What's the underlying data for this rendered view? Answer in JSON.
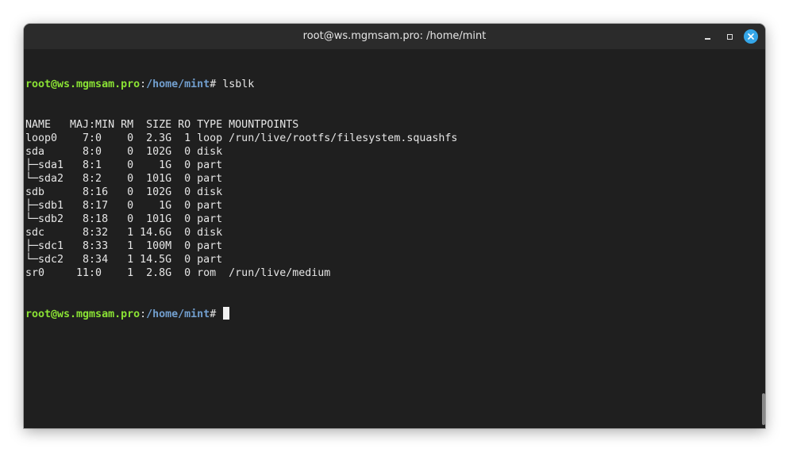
{
  "window": {
    "title": "root@ws.mgmsam.pro: /home/mint"
  },
  "prompt": {
    "user_host": "root@ws.mgmsam.pro",
    "separator": ":",
    "path": "/home/mint",
    "symbol": "# "
  },
  "commands": {
    "first": "lsblk",
    "second": ""
  },
  "output": {
    "lines": [
      "NAME   MAJ:MIN RM  SIZE RO TYPE MOUNTPOINTS",
      "loop0    7:0    0  2.3G  1 loop /run/live/rootfs/filesystem.squashfs",
      "sda      8:0    0  102G  0 disk",
      "├─sda1   8:1    0    1G  0 part",
      "└─sda2   8:2    0  101G  0 part",
      "sdb      8:16   0  102G  0 disk",
      "├─sdb1   8:17   0    1G  0 part",
      "└─sdb2   8:18   0  101G  0 part",
      "sdc      8:32   1 14.6G  0 disk",
      "├─sdc1   8:33   1  100M  0 part",
      "└─sdc2   8:34   1 14.5G  0 part",
      "sr0     11:0    1  2.8G  0 rom  /run/live/medium"
    ]
  },
  "icons": {
    "minimize": "minimize-icon",
    "maximize": "maximize-icon",
    "close": "close-icon"
  },
  "colors": {
    "prompt_user": "#8ae234",
    "prompt_path": "#729fcf",
    "close_button": "#35a6e8",
    "background": "#1f1f1f"
  }
}
